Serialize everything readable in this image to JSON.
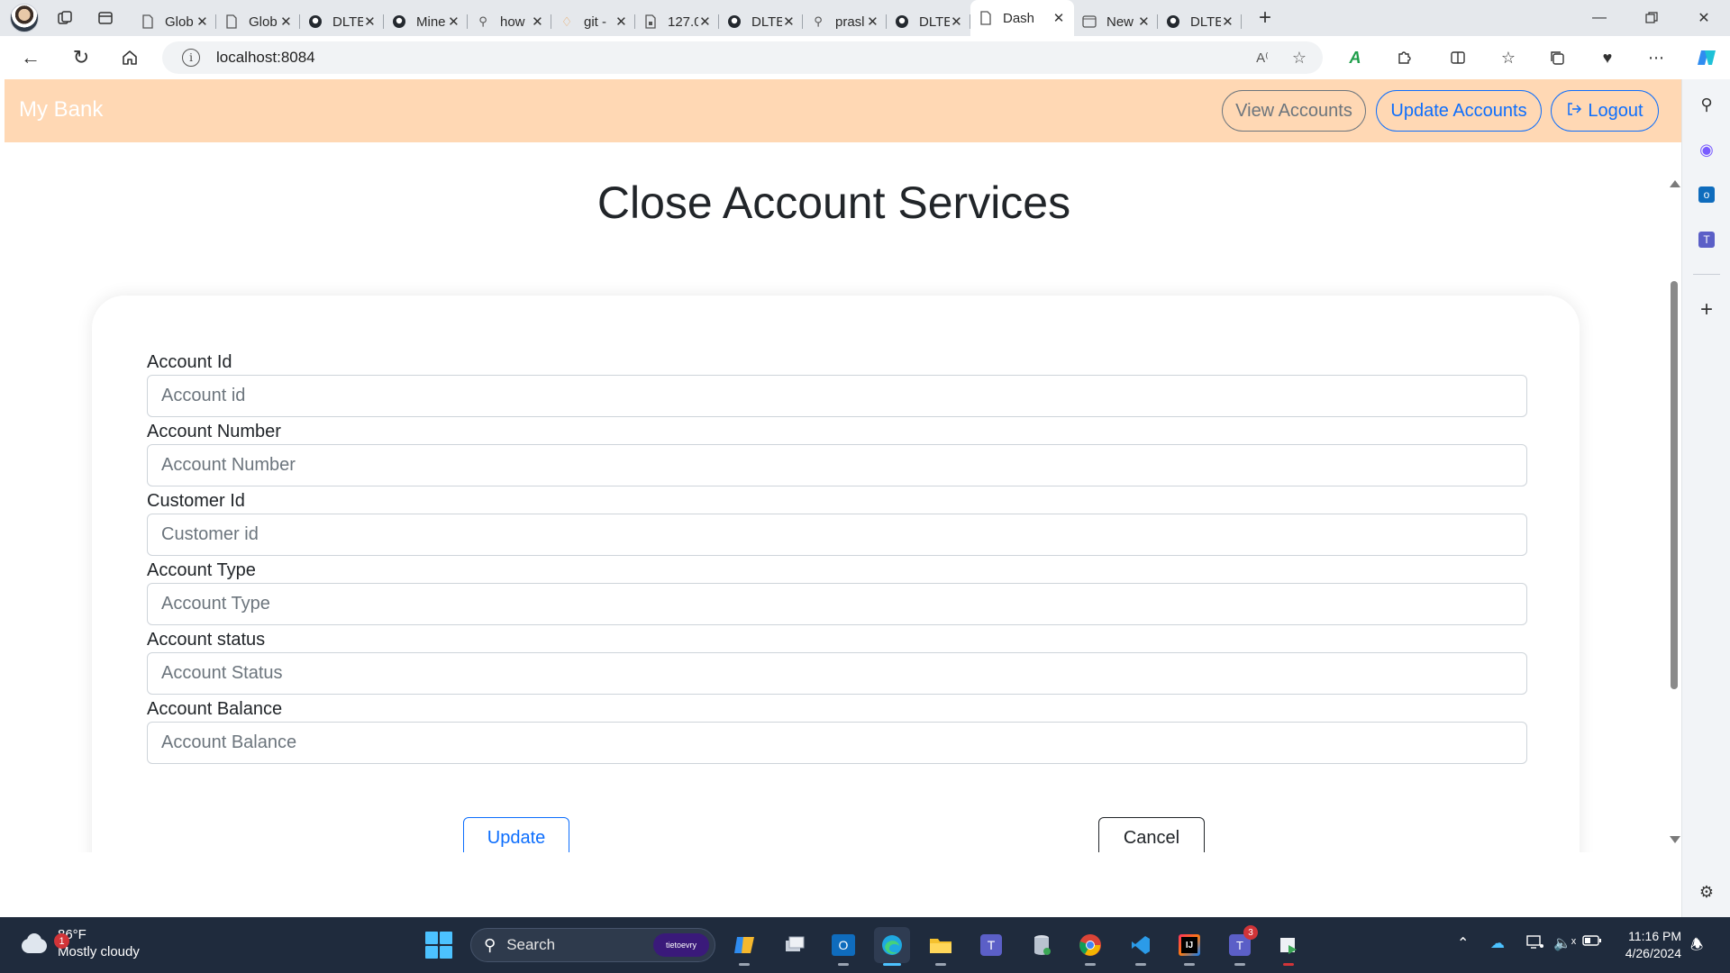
{
  "browser": {
    "tabs": [
      {
        "title": "Glob",
        "icon": "page-icon"
      },
      {
        "title": "Glob",
        "icon": "page-icon"
      },
      {
        "title": "DLTE",
        "icon": "github-icon"
      },
      {
        "title": "Mine",
        "icon": "github-icon"
      },
      {
        "title": "how",
        "icon": "search-icon"
      },
      {
        "title": "git -",
        "icon": "git-icon"
      },
      {
        "title": "127.0",
        "icon": "lock-page-icon"
      },
      {
        "title": "DLTE",
        "icon": "github-icon"
      },
      {
        "title": "prasl",
        "icon": "search-icon"
      },
      {
        "title": "DLTE",
        "icon": "github-icon"
      },
      {
        "title": "Dash",
        "icon": "page-icon",
        "active": true
      },
      {
        "title": "New",
        "icon": "newtab-icon"
      },
      {
        "title": "DLTE",
        "icon": "github-icon"
      }
    ],
    "url": "localhost:8084"
  },
  "app": {
    "brand": "My Bank",
    "nav": {
      "view_accounts": "View Accounts",
      "update_accounts": "Update Accounts",
      "logout": "Logout"
    },
    "page_title": "Close Account Services",
    "form": {
      "fields": [
        {
          "label": "Account Id",
          "placeholder": "Account id",
          "value": ""
        },
        {
          "label": "Account Number",
          "placeholder": "Account Number",
          "value": ""
        },
        {
          "label": "Customer Id",
          "placeholder": "Customer id",
          "value": ""
        },
        {
          "label": "Account Type",
          "placeholder": "Account Type",
          "value": ""
        },
        {
          "label": "Account status",
          "placeholder": "Account Status",
          "value": ""
        },
        {
          "label": "Account Balance",
          "placeholder": "Account Balance",
          "value": ""
        }
      ],
      "update_label": "Update",
      "cancel_label": "Cancel"
    },
    "colors": {
      "navbar": "#ffd8b4",
      "primary": "#0d6efd",
      "secondary": "#6c757d"
    }
  },
  "taskbar": {
    "weather": {
      "temp": "86°F",
      "condition": "Mostly cloudy",
      "badge": "1"
    },
    "search_placeholder": "Search",
    "search_pill": "tietoevry",
    "teams_badge": "3",
    "time": "11:16 PM",
    "date": "4/26/2024"
  }
}
